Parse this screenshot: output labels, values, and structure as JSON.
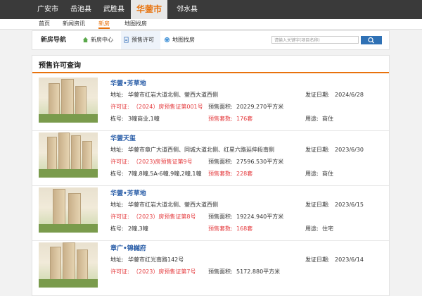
{
  "city_nav": [
    "广安市",
    "岳池县",
    "武胜县",
    "华蓥市",
    "邻水县"
  ],
  "city_nav_active": "华蓥市",
  "sub_nav": [
    "首页",
    "新闻资讯",
    "新房",
    "地图找房"
  ],
  "sub_nav_active": "新房",
  "house_nav": {
    "title": "新房导航",
    "tabs": [
      {
        "label": "新房中心",
        "icon": "house-icon"
      },
      {
        "label": "预售许可",
        "icon": "document-icon"
      },
      {
        "label": "地图找房",
        "icon": "globe-icon"
      }
    ],
    "active_tab": "预售许可"
  },
  "search": {
    "placeholder": "请输入关键字(项目名称)"
  },
  "section_title": "预售许可查询",
  "field_labels": {
    "address": "地址:",
    "permit": "许可证:",
    "issue_date": "发证日期:",
    "area": "预售面积:",
    "units": "预售套数:",
    "buildings": "栋号:",
    "usage": "用途:"
  },
  "listings": [
    {
      "name": "华蓥•芳草地",
      "address": "华蓥市红岩大道北侧、蓥西大道西侧",
      "issue_date": "2024/6/28",
      "permit": "（2024）房预售证第001号",
      "area": "20229.270平方米",
      "buildings": "3幢商业,1幢",
      "units": "176套",
      "usage": "商住"
    },
    {
      "name": "华蓥天玺",
      "address": "华蓥市章广大道西侧、同城大道北侧、红星六路延伸段南侧",
      "issue_date": "2023/6/30",
      "permit": "（2023)房预售证第9号",
      "area": "27596.530平方米",
      "buildings": "7幢,8幢,5A-6幢,9幢,2幢,1幢",
      "units": "228套",
      "usage": "商住"
    },
    {
      "name": "华蓥•芳草地",
      "address": "华蓥市红岩大道北侧、蓥西大道西侧",
      "issue_date": "2023/6/15",
      "permit": "（2023）房预售证第8号",
      "area": "19224.940平方米",
      "buildings": "2幢,3幢",
      "units": "168套",
      "usage": "住宅"
    },
    {
      "name": "章广•锦樾府",
      "address": "华蓥市红光南路142号",
      "issue_date": "2023/6/14",
      "permit": "（2023）房预售证第7号",
      "area": "5172.880平方米",
      "buildings": "",
      "units": "",
      "usage": ""
    }
  ]
}
